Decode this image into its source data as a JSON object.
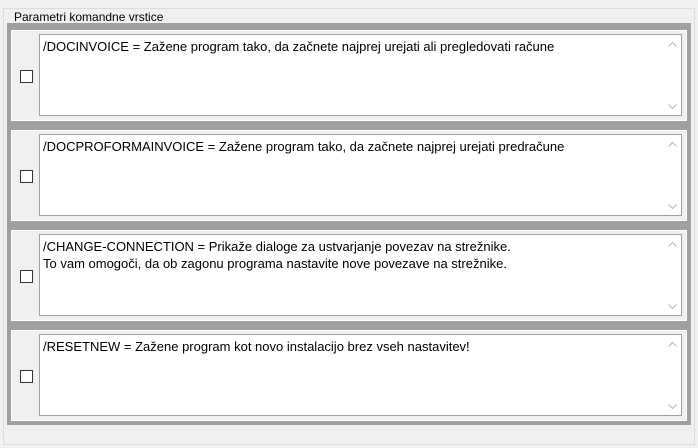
{
  "group": {
    "title": "Parametri komandne vrstice"
  },
  "options": [
    {
      "checked": false,
      "text": "/DOCINVOICE = Zažene program tako, da začnete najprej urejati ali pregledovati račune"
    },
    {
      "checked": false,
      "text": "/DOCPROFORMAINVOICE = Zažene program tako, da začnete najprej urejati predračune"
    },
    {
      "checked": false,
      "text": "/CHANGE-CONNECTION = Prikaže dialoge za ustvarjanje povezav na strežnike.\nTo vam omogoči, da ob zagonu programa nastavite nove povezave na strežnike."
    },
    {
      "checked": false,
      "text": "/RESETNEW = Zažene program kot novo instalacijo brez vseh nastavitev!"
    }
  ],
  "icons": {
    "scroll_up": "chevron-up-icon",
    "scroll_down": "chevron-down-icon"
  }
}
